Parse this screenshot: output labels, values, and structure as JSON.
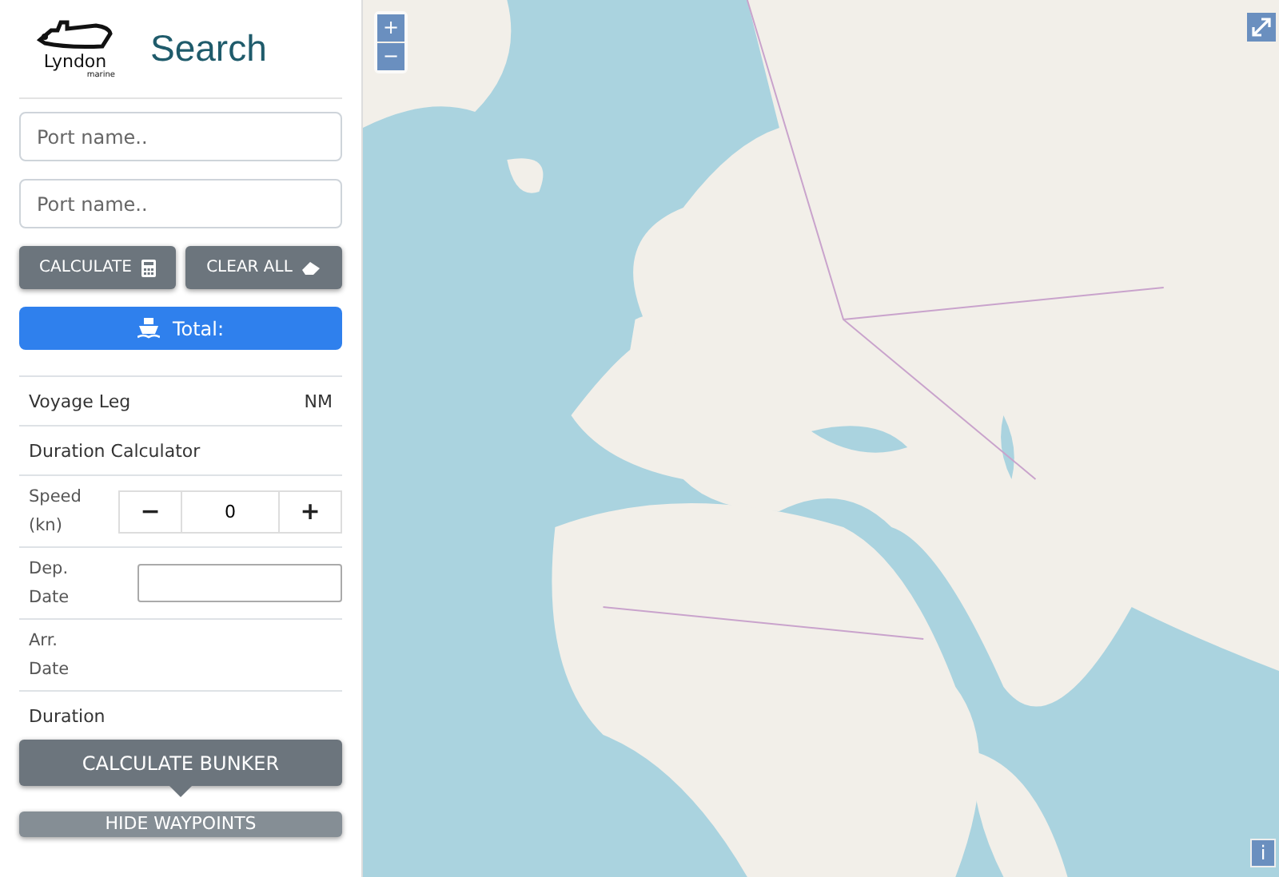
{
  "logo": {
    "name": "Lyndon",
    "tagline": "marine"
  },
  "header": {
    "title": "Search"
  },
  "port_fields": [
    {
      "placeholder": "Port name.."
    },
    {
      "placeholder": "Port name.."
    }
  ],
  "actions": [
    {
      "label": "CALCULATE"
    },
    {
      "label": "CLEAR ALL"
    }
  ],
  "total_button": {
    "label": "Total:"
  },
  "voyage": {
    "label": "Voyage Leg",
    "unit": "NM"
  },
  "duration_calculator": {
    "title": "Duration Calculator",
    "speed_label": "Speed (kn)",
    "decrement": "−",
    "speed_value": "0",
    "increment": "+",
    "dep_label": "Dep. Date",
    "arr_label": "Arr. Date",
    "duration_label": "Duration"
  },
  "bottom_buttons": [
    {
      "label": "CALCULATE BUNKER"
    },
    {
      "label": "HIDE WAYPOINTS"
    }
  ],
  "map": {
    "kind": "picture",
    "zoom_in": "+",
    "zoom_out": "−",
    "info": "i"
  }
}
